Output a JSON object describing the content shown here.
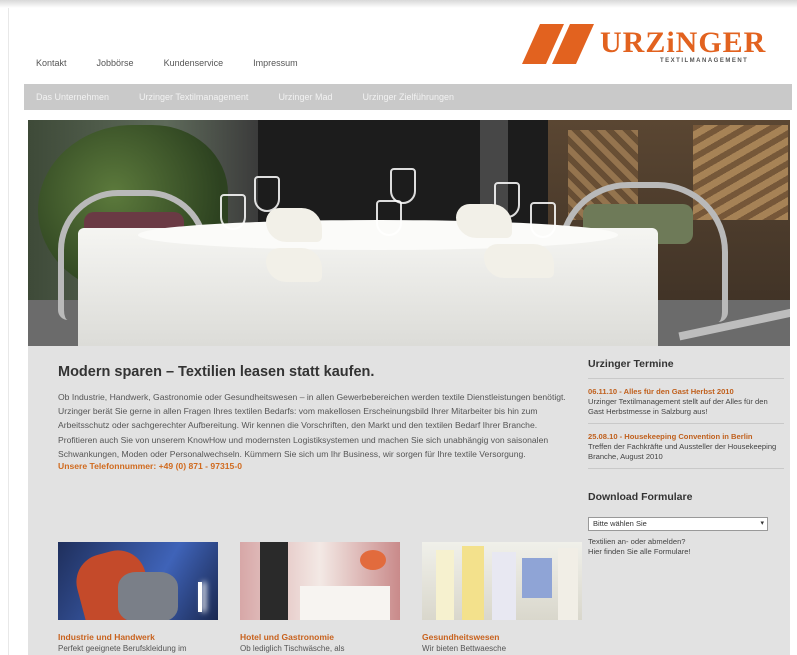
{
  "nav_top": [
    "Kontakt",
    "Jobbörse",
    "Kundenservice",
    "Impressum"
  ],
  "menubar": [
    "Das Unternehmen",
    "Urzinger Textilmanagement",
    "Urzinger Mad",
    "Urzinger Zielführungen"
  ],
  "logo": {
    "word": "URZiNGER",
    "sub": "TEXTILMANAGEMENT",
    "brand_color": "#e2621f"
  },
  "main": {
    "headline": "Modern sparen – Textilien leasen statt kaufen.",
    "body": "Ob Industrie, Handwerk, Gastronomie oder Gesundheitswesen – in allen Gewerbebereichen werden textile Dienstleistungen benötigt. Urzinger berät Sie gerne in allen Fragen Ihres textilen Bedarfs: vom makellosen Erscheinungsbild Ihrer Mitarbeiter bis hin zum Arbeitsschutz oder sachgerechter Aufbereitung. Wir kennen die Vorschriften, den Markt und den textilen Bedarf Ihrer Branche. Profitieren auch Sie von unserem KnowHow und modernsten Logistiksystemen und machen Sie sich unabhängig von saisonalen Schwankungen, Moden oder Personalwechseln. Kümmern Sie sich um Ihr Business, wir sorgen für Ihre textile Versorgung.",
    "phone": "Unsere Telefonnummer: +49 (0) 871 - 97315-0"
  },
  "teasers": [
    {
      "title": "Industrie und Handwerk",
      "text": "Perfekt geeignete Berufskleidung im"
    },
    {
      "title": "Hotel und Gastronomie",
      "text": "Ob lediglich Tischwäsche, als"
    },
    {
      "title": "Gesundheitswesen",
      "text": "Wir bieten Bettwaesche"
    }
  ],
  "sidebar": {
    "title": "Urzinger Termine",
    "events": [
      {
        "date": "06.11.10 - Alles für den Gast Herbst 2010",
        "text": "Urzinger Textilmanagement stellt auf der Alles für den Gast Herbstmesse in Salzburg aus!"
      },
      {
        "date": "25.08.10 - Housekeeping Convention in Berlin",
        "text": "Treffen der Fachkräfte und Aussteller der Housekeeping Branche, August 2010"
      }
    ],
    "download_title": "Download Formulare",
    "select_value": "Bitte wählen Sie",
    "note_line1": "Textilien an- oder abmelden?",
    "note_line2": "Hier finden Sie alle Formulare!"
  }
}
